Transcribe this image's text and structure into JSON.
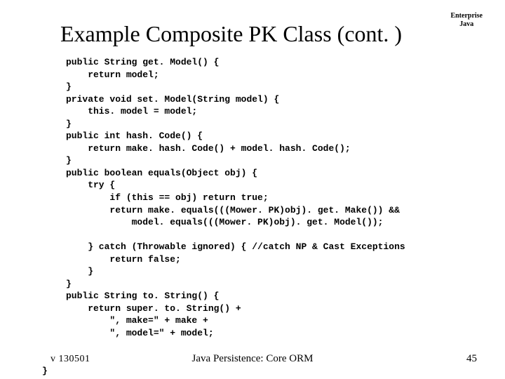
{
  "badge": {
    "line1": "Enterprise",
    "line2": "Java"
  },
  "title": "Example Composite PK Class (cont. )",
  "code": "public String get. Model() {\n    return model;\n}\nprivate void set. Model(String model) {\n    this. model = model;\n}\npublic int hash. Code() {\n    return make. hash. Code() + model. hash. Code();\n}\npublic boolean equals(Object obj) {\n    try {\n        if (this == obj) return true;\n        return make. equals(((Mower. PK)obj). get. Make()) &&\n            model. equals(((Mower. PK)obj). get. Model());\n\n    } catch (Throwable ignored) { //catch NP & Cast Exceptions\n        return false;\n    }\n}\npublic String to. String() {\n    return super. to. String() +\n        \", make=\" + make +\n        \", model=\" + model;",
  "footer": {
    "left": "v 130501",
    "center": "Java Persistence: Core ORM",
    "right": "45"
  },
  "closing": "}"
}
